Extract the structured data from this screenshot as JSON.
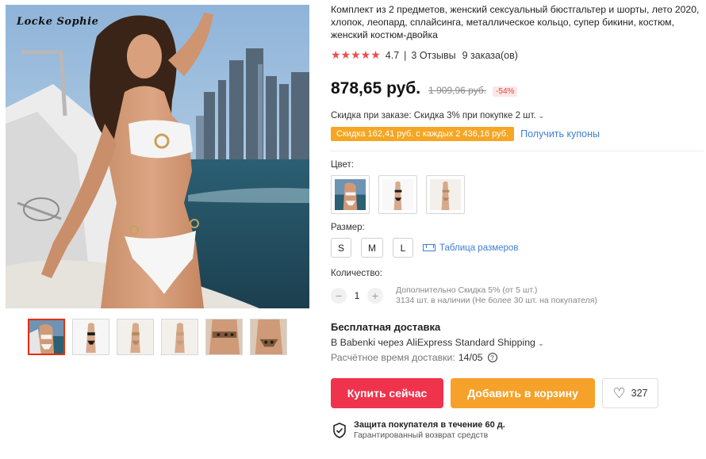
{
  "gallery": {
    "watermark": "Locke Sophie",
    "thumbnail_count": 6,
    "active_thumbnail": 0
  },
  "product": {
    "title": "Комплект из 2 предметов, женский сексуальный бюстгальтер и шорты, лето 2020, хлопок, леопард, сплайсинга, металлическое кольцо, супер бикини, костюм, женский костюм-двойка",
    "rating_stars": "★★★★★",
    "rating": "4.7",
    "reviews": "3 Отзывы",
    "orders": "9 заказа(ов)"
  },
  "price": {
    "current": "878,65 руб.",
    "old": "1 909,96 руб.",
    "discount": "-54%"
  },
  "promo": {
    "order_discount": "Скидка при заказе: Скидка 3% при покупке 2 шт.",
    "coupon_text": "Скидка 162,41 руб. с каждых 2 436,16 руб.",
    "coupon_link": "Получить купоны"
  },
  "options": {
    "color_label": "Цвет:",
    "size_label": "Размер:",
    "sizes": [
      "S",
      "M",
      "L"
    ],
    "size_chart": "Таблица размеров",
    "quantity_label": "Количество:",
    "quantity": "1",
    "qty_info_1": "Дополнительно Скидка 5% (от 5 шт.)",
    "qty_info_2": "3134 шт. в наличии (Не более 30 шт. на покупателя)"
  },
  "shipping": {
    "title": "Бесплатная доставка",
    "line": "В Babenki через AliExpress Standard Shipping",
    "est_label": "Расчётное время доставки:",
    "est_value": "14/05"
  },
  "actions": {
    "buy": "Купить сейчас",
    "cart": "Добавить в корзину",
    "wishlist_count": "327"
  },
  "protection": {
    "title": "Защита покупателя в течение 60 д.",
    "subtitle": "Гарантированный возврат средств"
  },
  "colors": {
    "buy_button": "#f0334c",
    "cart_button": "#f5a12a",
    "coupon_tag": "#f5a623",
    "link": "#3d7fd6",
    "stars": "#f04b4b"
  }
}
